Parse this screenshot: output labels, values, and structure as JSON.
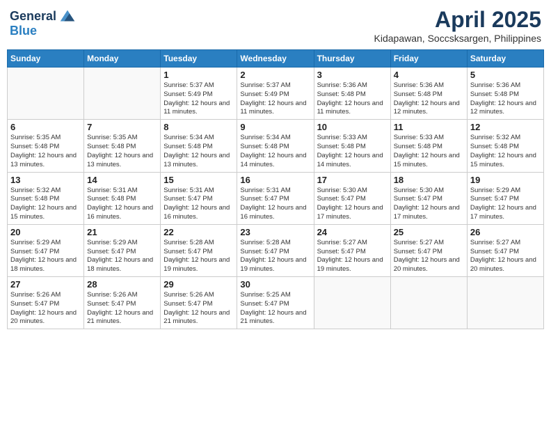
{
  "header": {
    "logo_line1": "General",
    "logo_line2": "Blue",
    "month": "April 2025",
    "location": "Kidapawan, Soccsksargen, Philippines"
  },
  "weekdays": [
    "Sunday",
    "Monday",
    "Tuesday",
    "Wednesday",
    "Thursday",
    "Friday",
    "Saturday"
  ],
  "days": [
    {
      "num": "",
      "sunrise": "",
      "sunset": "",
      "daylight": ""
    },
    {
      "num": "",
      "sunrise": "",
      "sunset": "",
      "daylight": ""
    },
    {
      "num": "1",
      "sunrise": "Sunrise: 5:37 AM",
      "sunset": "Sunset: 5:49 PM",
      "daylight": "Daylight: 12 hours and 11 minutes."
    },
    {
      "num": "2",
      "sunrise": "Sunrise: 5:37 AM",
      "sunset": "Sunset: 5:49 PM",
      "daylight": "Daylight: 12 hours and 11 minutes."
    },
    {
      "num": "3",
      "sunrise": "Sunrise: 5:36 AM",
      "sunset": "Sunset: 5:48 PM",
      "daylight": "Daylight: 12 hours and 11 minutes."
    },
    {
      "num": "4",
      "sunrise": "Sunrise: 5:36 AM",
      "sunset": "Sunset: 5:48 PM",
      "daylight": "Daylight: 12 hours and 12 minutes."
    },
    {
      "num": "5",
      "sunrise": "Sunrise: 5:36 AM",
      "sunset": "Sunset: 5:48 PM",
      "daylight": "Daylight: 12 hours and 12 minutes."
    },
    {
      "num": "6",
      "sunrise": "Sunrise: 5:35 AM",
      "sunset": "Sunset: 5:48 PM",
      "daylight": "Daylight: 12 hours and 13 minutes."
    },
    {
      "num": "7",
      "sunrise": "Sunrise: 5:35 AM",
      "sunset": "Sunset: 5:48 PM",
      "daylight": "Daylight: 12 hours and 13 minutes."
    },
    {
      "num": "8",
      "sunrise": "Sunrise: 5:34 AM",
      "sunset": "Sunset: 5:48 PM",
      "daylight": "Daylight: 12 hours and 13 minutes."
    },
    {
      "num": "9",
      "sunrise": "Sunrise: 5:34 AM",
      "sunset": "Sunset: 5:48 PM",
      "daylight": "Daylight: 12 hours and 14 minutes."
    },
    {
      "num": "10",
      "sunrise": "Sunrise: 5:33 AM",
      "sunset": "Sunset: 5:48 PM",
      "daylight": "Daylight: 12 hours and 14 minutes."
    },
    {
      "num": "11",
      "sunrise": "Sunrise: 5:33 AM",
      "sunset": "Sunset: 5:48 PM",
      "daylight": "Daylight: 12 hours and 15 minutes."
    },
    {
      "num": "12",
      "sunrise": "Sunrise: 5:32 AM",
      "sunset": "Sunset: 5:48 PM",
      "daylight": "Daylight: 12 hours and 15 minutes."
    },
    {
      "num": "13",
      "sunrise": "Sunrise: 5:32 AM",
      "sunset": "Sunset: 5:48 PM",
      "daylight": "Daylight: 12 hours and 15 minutes."
    },
    {
      "num": "14",
      "sunrise": "Sunrise: 5:31 AM",
      "sunset": "Sunset: 5:48 PM",
      "daylight": "Daylight: 12 hours and 16 minutes."
    },
    {
      "num": "15",
      "sunrise": "Sunrise: 5:31 AM",
      "sunset": "Sunset: 5:47 PM",
      "daylight": "Daylight: 12 hours and 16 minutes."
    },
    {
      "num": "16",
      "sunrise": "Sunrise: 5:31 AM",
      "sunset": "Sunset: 5:47 PM",
      "daylight": "Daylight: 12 hours and 16 minutes."
    },
    {
      "num": "17",
      "sunrise": "Sunrise: 5:30 AM",
      "sunset": "Sunset: 5:47 PM",
      "daylight": "Daylight: 12 hours and 17 minutes."
    },
    {
      "num": "18",
      "sunrise": "Sunrise: 5:30 AM",
      "sunset": "Sunset: 5:47 PM",
      "daylight": "Daylight: 12 hours and 17 minutes."
    },
    {
      "num": "19",
      "sunrise": "Sunrise: 5:29 AM",
      "sunset": "Sunset: 5:47 PM",
      "daylight": "Daylight: 12 hours and 17 minutes."
    },
    {
      "num": "20",
      "sunrise": "Sunrise: 5:29 AM",
      "sunset": "Sunset: 5:47 PM",
      "daylight": "Daylight: 12 hours and 18 minutes."
    },
    {
      "num": "21",
      "sunrise": "Sunrise: 5:29 AM",
      "sunset": "Sunset: 5:47 PM",
      "daylight": "Daylight: 12 hours and 18 minutes."
    },
    {
      "num": "22",
      "sunrise": "Sunrise: 5:28 AM",
      "sunset": "Sunset: 5:47 PM",
      "daylight": "Daylight: 12 hours and 19 minutes."
    },
    {
      "num": "23",
      "sunrise": "Sunrise: 5:28 AM",
      "sunset": "Sunset: 5:47 PM",
      "daylight": "Daylight: 12 hours and 19 minutes."
    },
    {
      "num": "24",
      "sunrise": "Sunrise: 5:27 AM",
      "sunset": "Sunset: 5:47 PM",
      "daylight": "Daylight: 12 hours and 19 minutes."
    },
    {
      "num": "25",
      "sunrise": "Sunrise: 5:27 AM",
      "sunset": "Sunset: 5:47 PM",
      "daylight": "Daylight: 12 hours and 20 minutes."
    },
    {
      "num": "26",
      "sunrise": "Sunrise: 5:27 AM",
      "sunset": "Sunset: 5:47 PM",
      "daylight": "Daylight: 12 hours and 20 minutes."
    },
    {
      "num": "27",
      "sunrise": "Sunrise: 5:26 AM",
      "sunset": "Sunset: 5:47 PM",
      "daylight": "Daylight: 12 hours and 20 minutes."
    },
    {
      "num": "28",
      "sunrise": "Sunrise: 5:26 AM",
      "sunset": "Sunset: 5:47 PM",
      "daylight": "Daylight: 12 hours and 21 minutes."
    },
    {
      "num": "29",
      "sunrise": "Sunrise: 5:26 AM",
      "sunset": "Sunset: 5:47 PM",
      "daylight": "Daylight: 12 hours and 21 minutes."
    },
    {
      "num": "30",
      "sunrise": "Sunrise: 5:25 AM",
      "sunset": "Sunset: 5:47 PM",
      "daylight": "Daylight: 12 hours and 21 minutes."
    },
    {
      "num": "",
      "sunrise": "",
      "sunset": "",
      "daylight": ""
    },
    {
      "num": "",
      "sunrise": "",
      "sunset": "",
      "daylight": ""
    },
    {
      "num": "",
      "sunrise": "",
      "sunset": "",
      "daylight": ""
    },
    {
      "num": "",
      "sunrise": "",
      "sunset": "",
      "daylight": ""
    }
  ]
}
